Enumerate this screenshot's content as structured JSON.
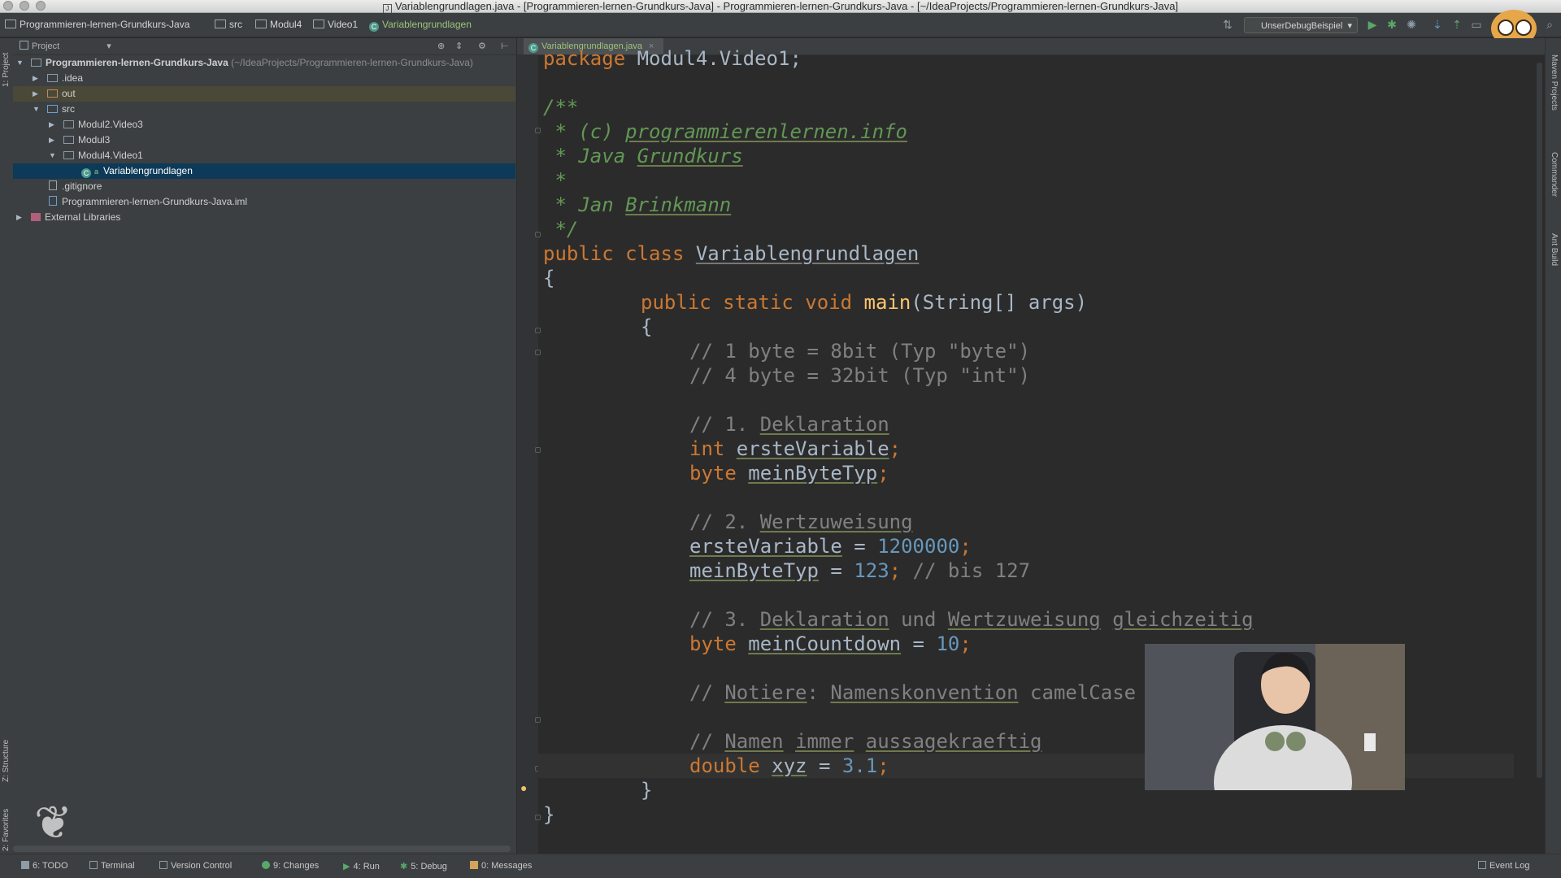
{
  "window": {
    "title": "Variablengrundlagen.java - [Programmieren-lernen-Grundkurs-Java] - Programmieren-lernen-Grundkurs-Java - [~/IdeaProjects/Programmieren-lernen-Grundkurs-Java]"
  },
  "breadcrumbs": [
    {
      "label": "Programmieren-lernen-Grundkurs-Java"
    },
    {
      "label": "src"
    },
    {
      "label": "Modul4"
    },
    {
      "label": "Video1"
    },
    {
      "label": "Variablengrundlagen"
    }
  ],
  "run_config": {
    "label": "UnserDebugBeispiel"
  },
  "project_panel": {
    "header": "Project",
    "tree": [
      {
        "label": "Programmieren-lernen-Grundkurs-Java",
        "suffix": "(~/IdeaProjects/Programmieren-lernen-Grundkurs-Java)"
      },
      {
        "label": ".idea"
      },
      {
        "label": "out"
      },
      {
        "label": "src"
      },
      {
        "label": "Modul2.Video3"
      },
      {
        "label": "Modul3"
      },
      {
        "label": "Modul4.Video1"
      },
      {
        "label": "Variablengrundlagen"
      },
      {
        "label": ".gitignore"
      },
      {
        "label": "Programmieren-lernen-Grundkurs-Java.iml"
      },
      {
        "label": "External Libraries"
      }
    ]
  },
  "left_tools": {
    "project": "1: Project",
    "structure": "Z: Structure",
    "favorites": "2: Favorites"
  },
  "right_tools": {
    "maven": "Maven Projects",
    "commander": "Commander",
    "ant": "Ant Build"
  },
  "editor": {
    "tab": "Variablengrundlagen.java",
    "code": {
      "l0": {
        "kw": "package",
        "rest": " Modul4.Video1;"
      },
      "l1": "/**",
      "l2": {
        "pre": " * (c) ",
        "url": "programmierenlernen.info"
      },
      "l3": {
        "pre": " * ",
        "a": "Java",
        "b": "Grundkurs"
      },
      "l4": " *",
      "l5": {
        "pre": " * ",
        "a": "Jan",
        "b": "Brinkmann"
      },
      "l6": " */",
      "l7": {
        "kw": "public class ",
        "name": "Variablengrundlagen"
      },
      "l8": "{",
      "l9": {
        "kw": "public static void ",
        "fn": "main",
        "rest": "(String[] args)"
      },
      "l10": "{",
      "l11": "// 1 byte = 8bit (Typ \"byte\")",
      "l12": "// 4 byte = 32bit (Typ \"int\")",
      "l13": {
        "pre": "// 1. ",
        "w": "Deklaration"
      },
      "l14": {
        "kw": "int ",
        "v": "ersteVariable",
        "rest": ";"
      },
      "l15": {
        "kw": "byte ",
        "v": "meinByteTyp",
        "rest": ";"
      },
      "l16": {
        "pre": "// 2. ",
        "w": "Wertzuweisung"
      },
      "l17": {
        "v": "ersteVariable",
        "mid": " = ",
        "num": "1200000",
        "rest": ";"
      },
      "l18": {
        "v": "meinByteTyp",
        "mid": " = ",
        "num": "123",
        "rest": "; ",
        "cm": "// bis 127"
      },
      "l19": {
        "pre": "// 3. ",
        "a": "Deklaration",
        "und": " und ",
        "b": "Wertzuweisung",
        "sp": " ",
        "c": "gleichzeitig"
      },
      "l20": {
        "kw": "byte ",
        "v": "meinCountdown",
        "mid": " = ",
        "num": "10",
        "rest": ";"
      },
      "l21": {
        "pre": "// ",
        "a": "Notiere",
        "colon": ": ",
        "b": "Namenskonvention",
        "rest": " camelCase"
      },
      "l22": {
        "pre": "// ",
        "a": "Namen",
        "sp1": " ",
        "b": "immer",
        "sp2": " ",
        "c": "aussagekraeftig"
      },
      "l23": {
        "kw": "double ",
        "v": "xyz",
        "mid": " = ",
        "num": "3.1",
        "rest": ";"
      },
      "l24": "}",
      "l25": "}"
    }
  },
  "bottom_tools": [
    {
      "label": "6: TODO"
    },
    {
      "label": "Terminal"
    },
    {
      "label": "Version Control"
    },
    {
      "label": "9: Changes"
    },
    {
      "label": "4: Run"
    },
    {
      "label": "5: Debug"
    },
    {
      "label": "0: Messages"
    },
    {
      "label": "Event Log"
    }
  ],
  "colors": {
    "keyword": "#cc7832",
    "comment": "#808080",
    "doc": "#629755",
    "number": "#6897bb",
    "method": "#ffc66d",
    "selection": "#0d3a58"
  }
}
